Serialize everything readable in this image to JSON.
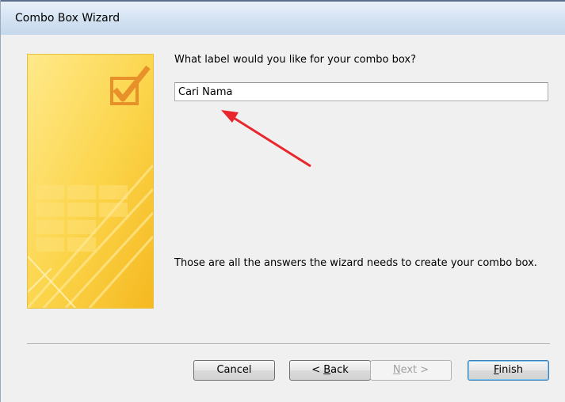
{
  "window": {
    "title": "Combo Box Wizard"
  },
  "wizard": {
    "question": "What label would you like for your combo box?",
    "label_value": "Cari Nama",
    "summary": "Those are all the answers the wizard needs to create your combo box."
  },
  "buttons": {
    "cancel": "Cancel",
    "back_prefix": "< ",
    "back_accel": "B",
    "back_rest": "ack",
    "next_accel": "N",
    "next_rest": "ext >",
    "finish_accel": "F",
    "finish_rest": "inish"
  },
  "colors": {
    "annotation_arrow": "#e8262b",
    "banner_yellow": "#f9c733",
    "banner_light": "#ffe98a",
    "checkmark": "#e8902a"
  },
  "icons": {
    "banner_check": "checkbox-check-icon"
  }
}
